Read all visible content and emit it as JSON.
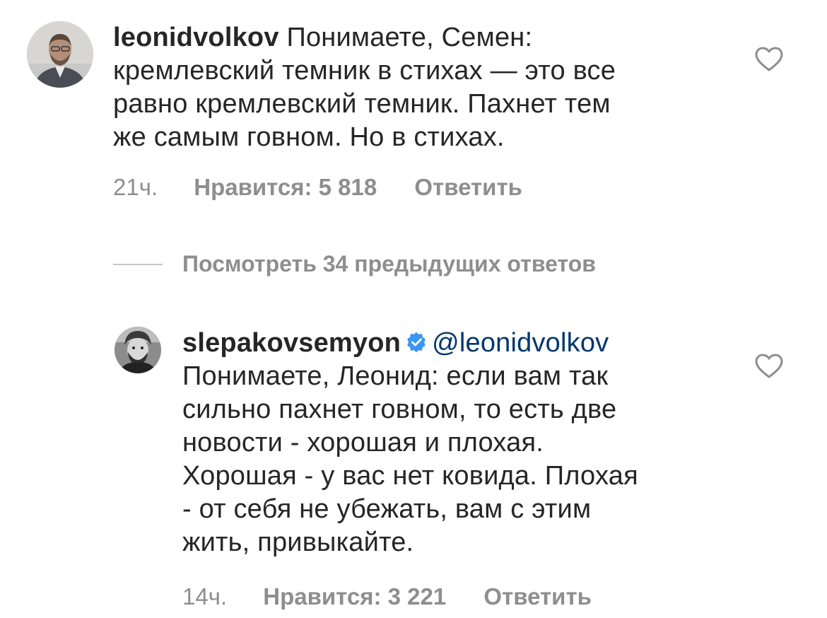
{
  "comments": [
    {
      "username": "leonidvolkov",
      "verified": false,
      "mention": "",
      "text": "Понимаете, Семен: кремлевский темник в стихах — это все равно кремлевский темник. Пахнет тем же самым говном. Но в стихах.",
      "lines": [
        "Понимаете, Семен:",
        "кремлевский темник в стихах — это все",
        "равно кремлевский темник. Пахнет тем",
        "же самым говном. Но в стихах."
      ],
      "time": "21ч.",
      "likes": "Нравится: 5 818",
      "reply": "Ответить",
      "avatar_icon": "profile-photo"
    },
    {
      "username": "slepakovsemyon",
      "verified": true,
      "mention": "@leonidvolkov",
      "lines": [
        "Понимаете, Леонид: если вам так",
        "сильно пахнет говном, то есть две",
        "новости - хорошая и плохая.",
        "Хорошая - у вас нет ковида. Плохая",
        "- от себя не убежать, вам с этим",
        "жить, привыкайте."
      ],
      "time": "14ч.",
      "likes": "Нравится: 3 221",
      "reply": "Ответить",
      "avatar_icon": "profile-photo"
    }
  ],
  "view_replies_label": "Посмотреть 34 предыдущих ответов",
  "icons": {
    "like": "heart-outline-icon",
    "verified": "verified-badge-icon"
  },
  "colors": {
    "text": "#262626",
    "secondary": "#8e8e8e",
    "mention": "#00376b",
    "verified": "#3897f0"
  }
}
